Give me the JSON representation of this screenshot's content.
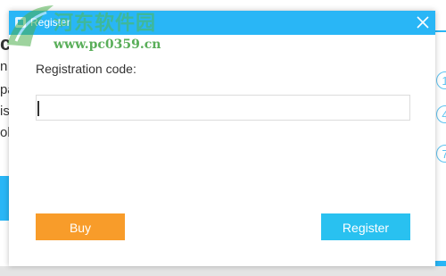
{
  "background": {
    "left_fragments": [
      "c",
      "n",
      "pa",
      "is",
      "ole"
    ],
    "right_markers": [
      "1",
      "4",
      "7"
    ]
  },
  "dialog": {
    "title": "Register",
    "close_label": "×",
    "registration_label": "Registration code:",
    "registration_value": "",
    "buy_label": "Buy",
    "register_label": "Register"
  },
  "watermark": {
    "title": "河东软件园",
    "url": "www.pc0359.cn"
  },
  "colors": {
    "accent": "#29b6f6",
    "buy": "#f89c2a",
    "register": "#29c1f0"
  }
}
